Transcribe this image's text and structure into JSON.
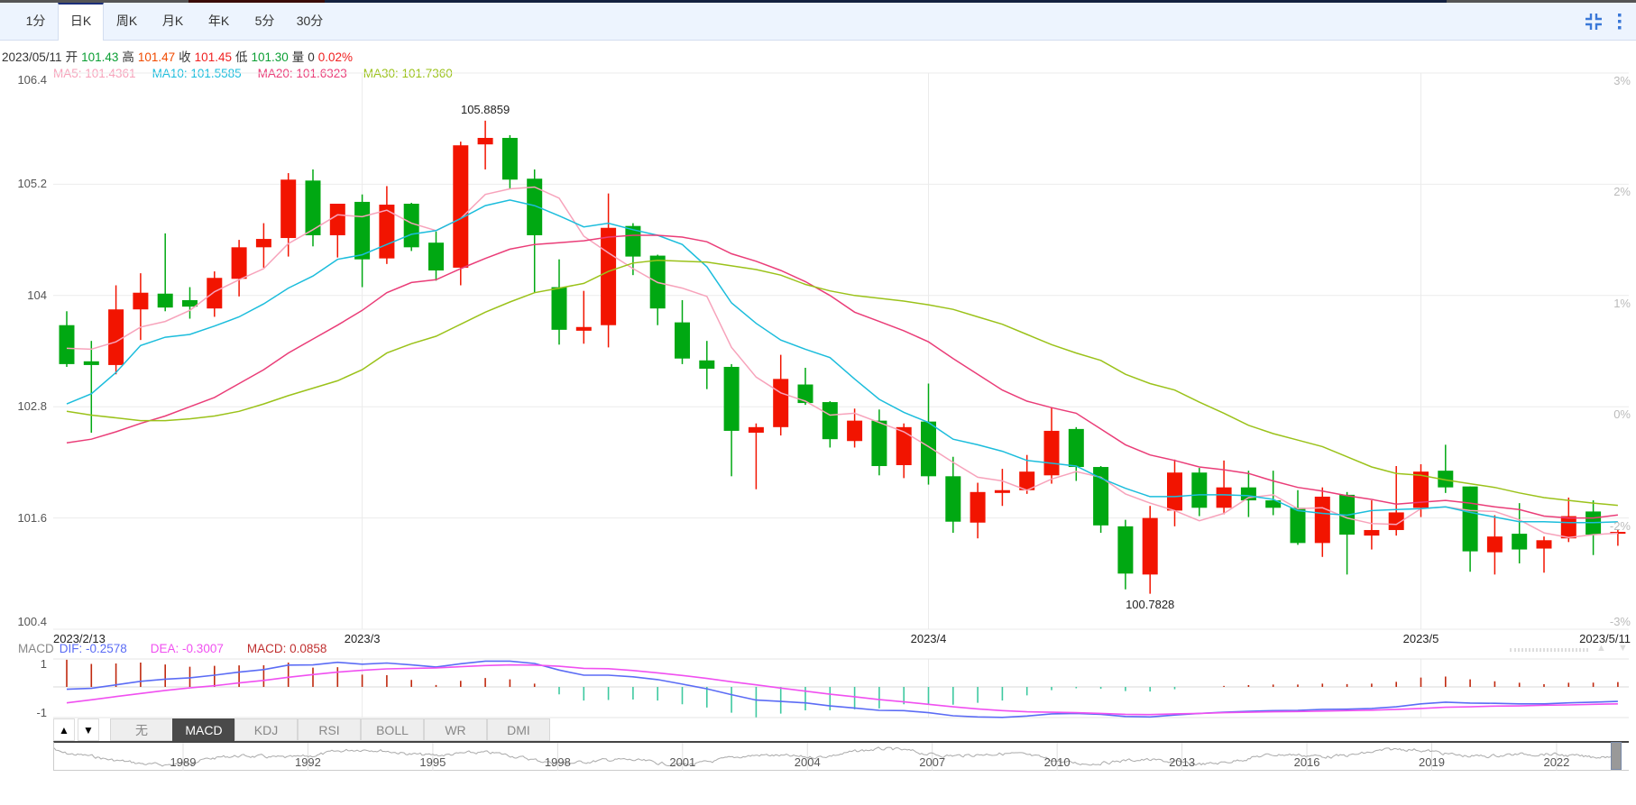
{
  "top_strip_colors": [
    "#555555",
    "#3a0c08",
    "#14213f",
    "#555555"
  ],
  "tabs": [
    {
      "label": "1分",
      "active": false
    },
    {
      "label": "日K",
      "active": true
    },
    {
      "label": "周K",
      "active": false
    },
    {
      "label": "月K",
      "active": false
    },
    {
      "label": "年K",
      "active": false
    },
    {
      "label": "5分",
      "active": false
    },
    {
      "label": "30分",
      "active": false
    }
  ],
  "toolbar_icons": [
    "compress-icon",
    "more-vertical-icon"
  ],
  "info": {
    "date": "2023/05/11",
    "open_label": "开",
    "open": "101.43",
    "high_label": "高",
    "high": "101.47",
    "close_label": "收",
    "close": "101.45",
    "low_label": "低",
    "low": "101.30",
    "volume_label": "量",
    "volume": "0",
    "change": "0.02%"
  },
  "ma_legend": [
    {
      "text": "MA5: 101.4361",
      "color": "#f7a3bb"
    },
    {
      "text": "MA10: 101.5585",
      "color": "#1cbddc"
    },
    {
      "text": "MA20: 101.6323",
      "color": "#ea3d78"
    },
    {
      "text": "MA30: 101.7360",
      "color": "#9bc21a"
    }
  ],
  "macd_legend": {
    "title": "MACD",
    "dif": "DIF: -0.2578",
    "dea": "DEA: -0.3007",
    "macd": "MACD: 0.0858"
  },
  "colors": {
    "up": "#f21400",
    "down": "#00a812",
    "hist_up": "#c0290f",
    "hist_down": "#3ec9a0",
    "dif": "#5b6cf5",
    "dea": "#f050f0",
    "ma5": "#f7a3bb",
    "ma10": "#1cbddc",
    "ma20": "#ea3d78",
    "ma30": "#9bc21a",
    "grid": "#ebebeb"
  },
  "indicator_tabs": [
    {
      "label": "无",
      "active": false
    },
    {
      "label": "MACD",
      "active": true
    },
    {
      "label": "KDJ",
      "active": false
    },
    {
      "label": "RSI",
      "active": false
    },
    {
      "label": "BOLL",
      "active": false
    },
    {
      "label": "WR",
      "active": false
    },
    {
      "label": "DMI",
      "active": false
    }
  ],
  "scroll_buttons": {
    "up": "▲",
    "down": "▼"
  },
  "navigator": {
    "years": [
      "1989",
      "1992",
      "1995",
      "1998",
      "2001",
      "2004",
      "2007",
      "2010",
      "2013",
      "2016",
      "2019",
      "2022"
    ]
  },
  "chart_data": {
    "type": "candlestick",
    "ylim": [
      100.4,
      106.4
    ],
    "y_ticks": [
      "106.4",
      "105.2",
      "104",
      "102.8",
      "101.6",
      "100.4"
    ],
    "y2_ticks": [
      "3%",
      "2%",
      "1%",
      "0%",
      "-2%",
      "-3%"
    ],
    "x_ticks": [
      {
        "label": "2023/2/13",
        "index": 0
      },
      {
        "label": "2023/3",
        "index": 12
      },
      {
        "label": "2023/4",
        "index": 35
      },
      {
        "label": "2023/5",
        "index": 55
      },
      {
        "label": "2023/5/11",
        "index": 63
      }
    ],
    "annotations": [
      {
        "text": "105.8859",
        "index": 17,
        "value": 105.8859,
        "position": "above"
      },
      {
        "text": "100.7828",
        "index": 44,
        "value": 100.7828,
        "position": "below"
      }
    ],
    "ohlc": [
      [
        103.68,
        103.83,
        103.23,
        103.26
      ],
      [
        103.29,
        103.51,
        102.52,
        103.25
      ],
      [
        103.25,
        104.11,
        103.15,
        103.85
      ],
      [
        103.85,
        104.24,
        103.52,
        104.03
      ],
      [
        104.02,
        104.67,
        103.83,
        103.87
      ],
      [
        103.95,
        104.09,
        103.75,
        103.88
      ],
      [
        103.86,
        104.26,
        103.77,
        104.19
      ],
      [
        104.18,
        104.6,
        103.99,
        104.52
      ],
      [
        104.52,
        104.78,
        104.3,
        104.61
      ],
      [
        104.62,
        105.32,
        104.42,
        105.25
      ],
      [
        105.24,
        105.36,
        104.53,
        104.65
      ],
      [
        104.65,
        104.99,
        104.41,
        104.99
      ],
      [
        105.01,
        105.09,
        104.09,
        104.39
      ],
      [
        104.4,
        105.18,
        104.34,
        104.98
      ],
      [
        104.99,
        105.0,
        104.48,
        104.52
      ],
      [
        104.57,
        104.69,
        104.16,
        104.27
      ],
      [
        104.3,
        105.66,
        104.11,
        105.62
      ],
      [
        105.63,
        105.8859,
        105.36,
        105.7
      ],
      [
        105.7,
        105.73,
        105.15,
        105.25
      ],
      [
        105.26,
        105.36,
        104.03,
        104.65
      ],
      [
        104.09,
        104.39,
        103.47,
        103.63
      ],
      [
        103.62,
        104.05,
        103.48,
        103.66
      ],
      [
        103.68,
        105.1,
        103.44,
        104.73
      ],
      [
        104.75,
        104.78,
        104.22,
        104.42
      ],
      [
        104.43,
        104.44,
        103.68,
        103.86
      ],
      [
        103.71,
        103.95,
        103.26,
        103.32
      ],
      [
        103.3,
        103.51,
        102.99,
        103.21
      ],
      [
        103.23,
        103.26,
        102.05,
        102.54
      ],
      [
        102.52,
        102.62,
        101.91,
        102.58
      ],
      [
        102.58,
        103.36,
        102.49,
        103.1
      ],
      [
        103.04,
        103.22,
        102.82,
        102.84
      ],
      [
        102.85,
        102.86,
        102.36,
        102.45
      ],
      [
        102.43,
        102.78,
        102.36,
        102.65
      ],
      [
        102.65,
        102.77,
        102.06,
        102.16
      ],
      [
        102.17,
        102.62,
        102.03,
        102.58
      ],
      [
        102.64,
        103.05,
        101.96,
        102.05
      ],
      [
        102.05,
        102.26,
        101.44,
        101.56
      ],
      [
        101.55,
        101.98,
        101.38,
        101.88
      ],
      [
        101.87,
        102.13,
        101.73,
        101.9
      ],
      [
        101.9,
        102.28,
        101.86,
        102.1
      ],
      [
        102.06,
        102.79,
        101.97,
        102.54
      ],
      [
        102.56,
        102.58,
        102.0,
        102.15
      ],
      [
        102.15,
        102.16,
        101.44,
        101.52
      ],
      [
        101.51,
        101.58,
        100.83,
        101.0
      ],
      [
        100.99,
        101.73,
        100.7828,
        101.6
      ],
      [
        101.68,
        102.23,
        101.51,
        102.09
      ],
      [
        102.09,
        102.14,
        101.62,
        101.71
      ],
      [
        101.71,
        102.22,
        101.64,
        101.93
      ],
      [
        101.93,
        102.11,
        101.61,
        101.79
      ],
      [
        101.79,
        102.11,
        101.63,
        101.71
      ],
      [
        101.71,
        101.9,
        101.31,
        101.33
      ],
      [
        101.33,
        101.93,
        101.18,
        101.83
      ],
      [
        101.85,
        101.88,
        100.99,
        101.42
      ],
      [
        101.41,
        101.79,
        101.26,
        101.47
      ],
      [
        101.47,
        102.16,
        101.41,
        101.66
      ],
      [
        101.71,
        102.18,
        101.61,
        102.1
      ],
      [
        102.11,
        102.39,
        101.87,
        101.93
      ],
      [
        101.94,
        101.94,
        101.02,
        101.24
      ],
      [
        101.23,
        101.63,
        100.99,
        101.4
      ],
      [
        101.43,
        101.76,
        101.11,
        101.26
      ],
      [
        101.27,
        101.4,
        101.01,
        101.36
      ],
      [
        101.38,
        101.82,
        101.34,
        101.62
      ],
      [
        101.67,
        101.79,
        101.2,
        101.42
      ],
      [
        101.43,
        101.47,
        101.3,
        101.45
      ]
    ],
    "ma": {
      "MA5": [
        103.43,
        103.42,
        103.5,
        103.66,
        103.72,
        103.84,
        104.04,
        104.17,
        104.29,
        104.56,
        104.71,
        104.87,
        104.85,
        104.92,
        104.78,
        104.7,
        104.83,
        105.09,
        105.15,
        105.17,
        105.05,
        104.64,
        104.46,
        104.29,
        104.14,
        104.08,
        103.99,
        103.44,
        103.12,
        102.95,
        102.86,
        102.71,
        102.73,
        102.63,
        102.53,
        102.37,
        102.2,
        102.04,
        102.0,
        101.9,
        102.02,
        102.1,
        102.04,
        101.86,
        101.76,
        101.68,
        101.57,
        101.65,
        101.82,
        101.85,
        101.7,
        101.71,
        101.6,
        101.54,
        101.53,
        101.7,
        101.72,
        101.68,
        101.67,
        101.58,
        101.44,
        101.39,
        101.42,
        101.4361
      ],
      "MA10": [
        102.83,
        102.94,
        103.17,
        103.46,
        103.55,
        103.58,
        103.67,
        103.77,
        103.91,
        104.08,
        104.21,
        104.39,
        104.44,
        104.55,
        104.66,
        104.7,
        104.83,
        104.97,
        105.03,
        104.97,
        104.86,
        104.74,
        104.78,
        104.71,
        104.65,
        104.55,
        104.31,
        103.92,
        103.7,
        103.52,
        103.42,
        103.33,
        103.1,
        102.88,
        102.74,
        102.63,
        102.45,
        102.39,
        102.32,
        102.22,
        102.19,
        102.16,
        102.03,
        101.92,
        101.83,
        101.83,
        101.85,
        101.85,
        101.84,
        101.8,
        101.68,
        101.65,
        101.63,
        101.68,
        101.69,
        101.7,
        101.72,
        101.66,
        101.61,
        101.56,
        101.56,
        101.55,
        101.55,
        101.5585
      ],
      "MA20": [
        102.41,
        102.45,
        102.53,
        102.62,
        102.7,
        102.8,
        102.9,
        103.05,
        103.2,
        103.38,
        103.53,
        103.68,
        103.84,
        104.03,
        104.14,
        104.17,
        104.29,
        104.4,
        104.5,
        104.55,
        104.57,
        104.59,
        104.63,
        104.65,
        104.65,
        104.63,
        104.58,
        104.45,
        104.37,
        104.27,
        104.15,
        104.0,
        103.82,
        103.72,
        103.62,
        103.5,
        103.32,
        103.15,
        102.98,
        102.86,
        102.79,
        102.73,
        102.56,
        102.39,
        102.28,
        102.22,
        102.15,
        102.12,
        102.08,
        102.0,
        101.93,
        101.89,
        101.84,
        101.8,
        101.75,
        101.77,
        101.79,
        101.76,
        101.72,
        101.69,
        101.62,
        101.6,
        101.6,
        101.6323
      ],
      "MA30": [
        102.75,
        102.71,
        102.68,
        102.65,
        102.65,
        102.67,
        102.7,
        102.75,
        102.83,
        102.92,
        103.0,
        103.08,
        103.2,
        103.38,
        103.48,
        103.56,
        103.69,
        103.82,
        103.93,
        104.03,
        104.08,
        104.13,
        104.26,
        104.35,
        104.38,
        104.37,
        104.36,
        104.32,
        104.28,
        104.22,
        104.12,
        104.05,
        104.0,
        103.97,
        103.94,
        103.9,
        103.85,
        103.77,
        103.69,
        103.58,
        103.47,
        103.38,
        103.3,
        103.15,
        103.05,
        102.98,
        102.85,
        102.73,
        102.6,
        102.51,
        102.44,
        102.37,
        102.26,
        102.15,
        102.08,
        102.06,
        102.01,
        101.97,
        101.93,
        101.87,
        101.82,
        101.79,
        101.76,
        101.736
      ]
    },
    "macd_panel": {
      "y_ticks": [
        "1",
        "-1"
      ],
      "dif": [
        -0.042,
        -0.025,
        0.037,
        0.1,
        0.137,
        0.162,
        0.208,
        0.262,
        0.308,
        0.387,
        0.391,
        0.437,
        0.404,
        0.424,
        0.391,
        0.354,
        0.412,
        0.458,
        0.458,
        0.416,
        0.3,
        0.208,
        0.208,
        0.179,
        0.129,
        0.05,
        -0.033,
        -0.137,
        -0.233,
        -0.258,
        -0.283,
        -0.337,
        -0.374,
        -0.416,
        -0.42,
        -0.458,
        -0.512,
        -0.532,
        -0.541,
        -0.516,
        -0.478,
        -0.47,
        -0.487,
        -0.524,
        -0.532,
        -0.499,
        -0.47,
        -0.449,
        -0.433,
        -0.42,
        -0.416,
        -0.399,
        -0.395,
        -0.383,
        -0.354,
        -0.3,
        -0.27,
        -0.287,
        -0.291,
        -0.3,
        -0.3,
        -0.283,
        -0.27,
        -0.2578
      ],
      "dea": [
        -0.283,
        -0.229,
        -0.171,
        -0.116,
        -0.062,
        -0.017,
        0.021,
        0.071,
        0.116,
        0.171,
        0.22,
        0.262,
        0.295,
        0.32,
        0.329,
        0.337,
        0.358,
        0.379,
        0.391,
        0.387,
        0.366,
        0.329,
        0.324,
        0.291,
        0.25,
        0.204,
        0.15,
        0.092,
        0.037,
        -0.021,
        -0.075,
        -0.129,
        -0.175,
        -0.225,
        -0.266,
        -0.308,
        -0.354,
        -0.391,
        -0.42,
        -0.441,
        -0.449,
        -0.458,
        -0.47,
        -0.487,
        -0.491,
        -0.478,
        -0.47,
        -0.458,
        -0.449,
        -0.441,
        -0.437,
        -0.428,
        -0.42,
        -0.412,
        -0.399,
        -0.383,
        -0.362,
        -0.354,
        -0.341,
        -0.337,
        -0.324,
        -0.32,
        -0.308,
        -0.3007
      ]
    }
  }
}
